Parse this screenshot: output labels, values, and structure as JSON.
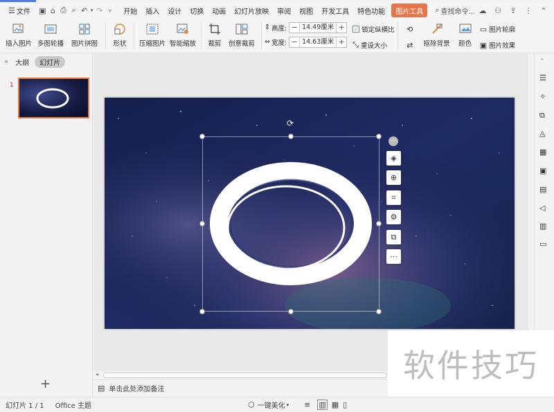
{
  "menubar": {
    "file_label": "文件",
    "tabs": [
      "开始",
      "插入",
      "设计",
      "切换",
      "动画",
      "幻灯片放映",
      "审阅",
      "视图",
      "开发工具",
      "特色功能"
    ],
    "active_tab": "图片工具",
    "search_label": "查找命令..."
  },
  "ribbon": {
    "insert_picture": "插入图片",
    "multi_outline": "多图轮播",
    "picture_collage": "图片拼图",
    "shape": "形状",
    "compress": "压缩图片",
    "smart_zoom": "智能缩放",
    "crop": "裁剪",
    "creative_crop": "创意裁剪",
    "height_label": "高度:",
    "height_value": "14.49厘米",
    "width_label": "宽度:",
    "width_value": "14.63厘米",
    "lock_ratio": "锁定纵横比",
    "reset_size": "重设大小",
    "remove_bg": "抠除背景",
    "color": "颜色",
    "pic_outline": "图片轮廓",
    "pic_effect": "图片效果"
  },
  "leftpane": {
    "outline_tab": "大纲",
    "slides_tab": "幻灯片",
    "slide_number": "1",
    "add_slide": "+"
  },
  "notes": {
    "placeholder": "单击此处添加备注"
  },
  "status": {
    "slide_info": "幻灯片 1 / 1",
    "theme": "Office 主题",
    "beautify": "一键美化"
  },
  "watermark": "软件技巧"
}
